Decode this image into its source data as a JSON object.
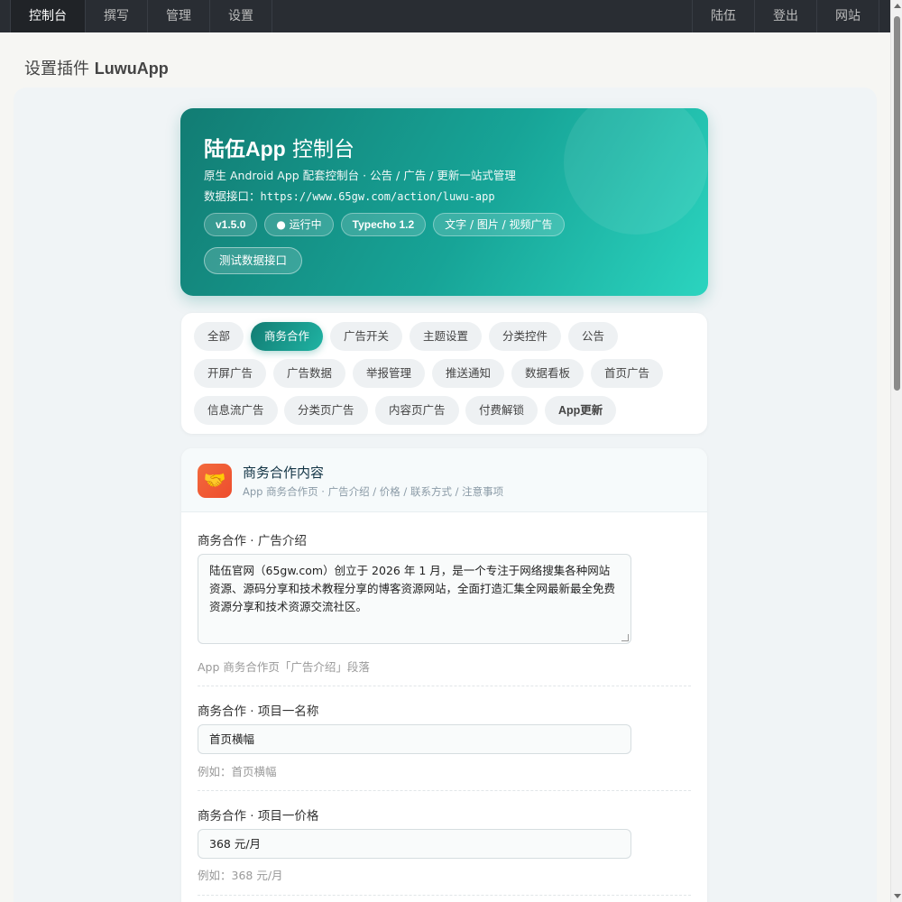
{
  "nav": {
    "left": [
      "控制台",
      "撰写",
      "管理",
      "设置"
    ],
    "right": [
      "陆伍",
      "登出",
      "网站"
    ]
  },
  "page": {
    "title_prefix": "设置插件",
    "title_name": "LuwuApp"
  },
  "hero": {
    "title_brand": "陆伍App",
    "title_rest": " 控制台",
    "subtitle": "原生 Android App 配套控制台 · 公告 / 广告 / 更新一站式管理",
    "api_label": "数据接口：",
    "api_url": "https://www.65gw.com/action/luwu-app",
    "badges": [
      "v1.5.0",
      "● 运行中",
      "Typecho 1.2",
      "文字 / 图片 / 视频广告"
    ],
    "test_button": "测试数据接口"
  },
  "tabs": {
    "active": "商务合作",
    "items": [
      "全部",
      "商务合作",
      "广告开关",
      "主题设置",
      "分类控件",
      "公告",
      "开屏广告",
      "广告数据",
      "举报管理",
      "推送通知",
      "数据看板",
      "首页广告",
      "信息流广告",
      "分类页广告",
      "内容页广告",
      "付费解锁",
      "App更新"
    ]
  },
  "section": {
    "icon": "handshake-icon",
    "title": "商务合作内容",
    "description": "App 商务合作页 · 广告介绍 / 价格 / 联系方式 / 注意事项",
    "fields": [
      {
        "label": "商务合作 · 广告介绍",
        "value": "陆伍官网（65gw.com）创立于 2026 年 1 月，是一个专注于网络搜集各种网站资源、源码分享和技术教程分享的博客资源网站，全面打造汇集全网最新最全免费资源分享和技术资源交流社区。",
        "hint": "App 商务合作页「广告介绍」段落"
      },
      {
        "label": "商务合作 · 项目一名称",
        "value": "首页横幅",
        "hint": "例如：首页横幅"
      },
      {
        "label": "商务合作 · 项目一价格",
        "value": "368 元/月",
        "hint": "例如：368 元/月"
      }
    ]
  },
  "colors": {
    "accent": "#17a497",
    "nav_bg": "#292d33",
    "icon_bg": "#ee4d2d"
  }
}
